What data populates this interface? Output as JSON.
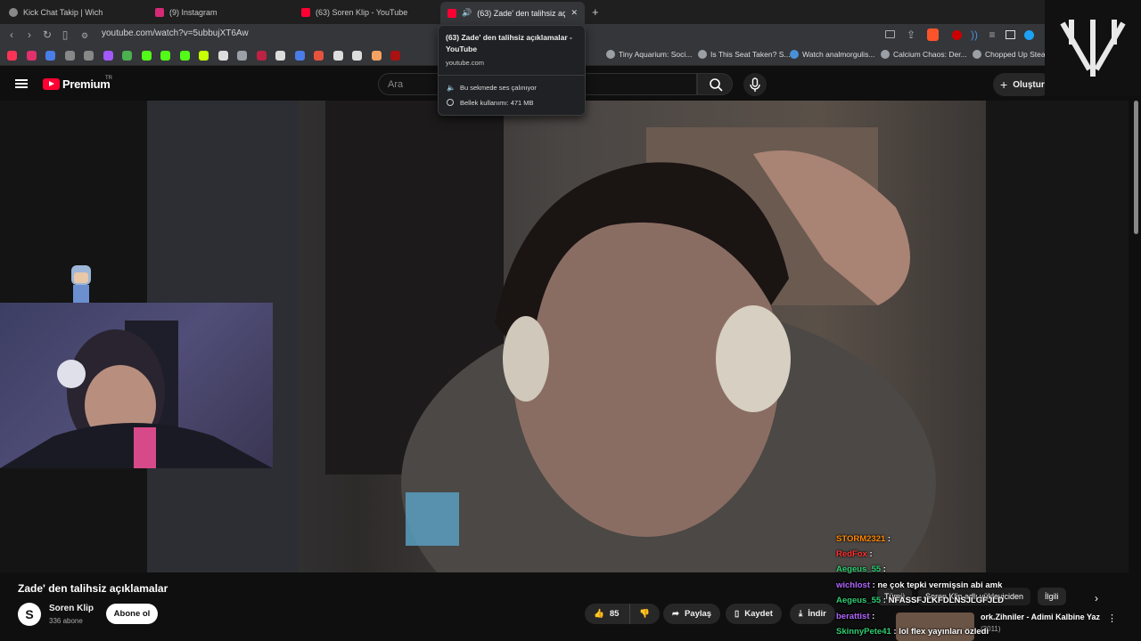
{
  "browser": {
    "tabs": [
      {
        "label": "Kick Chat Takip | Wich",
        "fav_color": "#888888"
      },
      {
        "label": "(9) Instagram",
        "fav_color": "#d62976"
      },
      {
        "label": "(63) Soren Klip - YouTube",
        "fav_color": "#ff0033"
      },
      {
        "label": "(63) Zade' den talihsiz açıklamalar",
        "fav_color": "#ff0033",
        "active": true
      }
    ],
    "new_tab": "+",
    "close": "✕",
    "url": "youtube.com/watch?v=5ubbujXT6Aw",
    "bookmarks": [
      {
        "label": "Tiny Aquarium: Soci...",
        "icon_color": "#9aa0a6"
      },
      {
        "label": "Is This Seat Taken? S...",
        "icon_color": "#9aa0a6"
      },
      {
        "label": "Watch analmorgulis...",
        "icon_color": "#4a90d9"
      },
      {
        "label": "Calcium Chaos: Der...",
        "icon_color": "#9aa0a6"
      },
      {
        "label": "Chopped Up Steam",
        "icon_color": "#9aa0a6"
      }
    ],
    "bookmark_icon_colors": [
      "#ff3355",
      "#e1306c",
      "#4a7de8",
      "#888",
      "#888",
      "#a259ff",
      "#4caf50",
      "#53fc18",
      "#53fc18",
      "#53fc18",
      "#c6ff00",
      "#dddddd",
      "#9aa0a6",
      "#bb2244",
      "#dddddd",
      "#4a7de8",
      "#e5533d",
      "#dddddd",
      "#dddddd",
      "#f4a261",
      "#aa1111"
    ]
  },
  "tooltip": {
    "title": "(63) Zade' den talihsiz açıklamalar - YouTube",
    "domain": "youtube.com",
    "audio": "Bu sekmede ses çalınıyor",
    "memory": "Bellek kullanımı: 471 MB"
  },
  "youtube": {
    "brand": "Premium",
    "region": "TR",
    "search_placeholder": "Ara",
    "create_label": "Oluştur",
    "video_title": "Zade' den talihsiz açıklamalar",
    "channel": {
      "initial": "S",
      "name": "Soren Klip",
      "subscribers": "336 abone"
    },
    "subscribe_label": "Abone ol",
    "likes": "85",
    "share_label": "Paylaş",
    "save_label": "Kaydet",
    "download_label": "İndir",
    "chips": [
      "Tümü",
      "Soren Klip adlı yükleyiciden",
      "İlgili"
    ],
    "related": {
      "title": "ork.Zihniler - Adimi Kalbine Yaz",
      "meta": "(2011)"
    }
  },
  "chat": [
    {
      "user": "STORM2321",
      "text": ":",
      "color": "#ff8800"
    },
    {
      "user": "RedFox",
      "text": ":",
      "color": "#ff3333"
    },
    {
      "user": "Aegeus_55",
      "text": ":",
      "color": "#2ecc71"
    },
    {
      "user": "wichlost",
      "text": ": ne çok tepki vermişsin abi amk",
      "color": "#b066ff"
    },
    {
      "user": "Aegeus_55",
      "text": ": NFASSFJLKFDLNSJLGFJLD",
      "color": "#2ecc71"
    },
    {
      "user": "berattist",
      "text": ":",
      "color": "#b066ff"
    },
    {
      "user": "SkinnyPete41",
      "text": ": lol flex yayınları özledi",
      "color": "#2ecc71"
    }
  ],
  "colors": {
    "accent": "#ff0033",
    "bg": "#0f0f0f"
  }
}
